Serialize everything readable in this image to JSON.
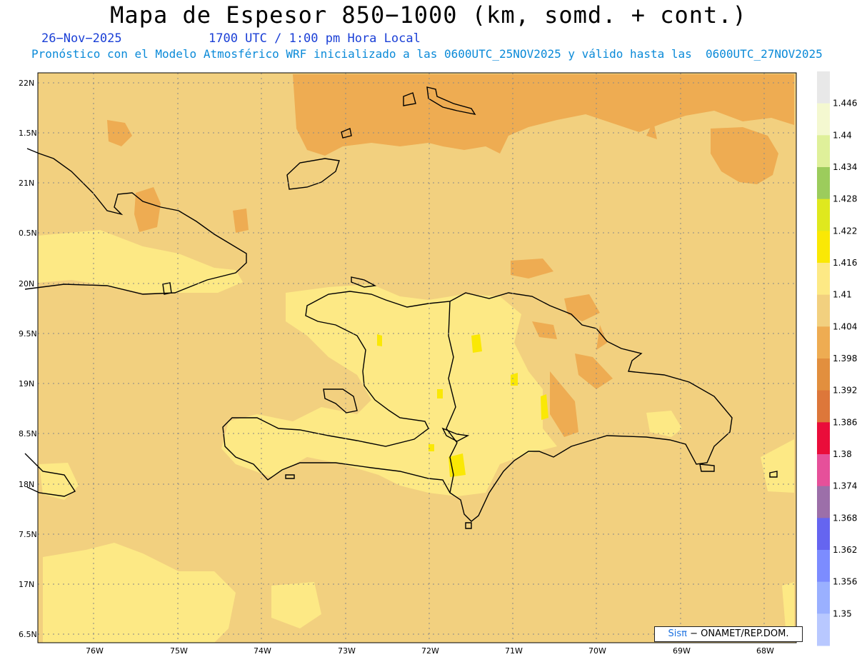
{
  "header": {
    "title": "Mapa de Espesor 850−1000 (km, somd. + cont.)",
    "date": "26−Nov−2025",
    "time": "1700 UTC / 1:00 pm Hora Local",
    "description": "Pronóstico con el Modelo Atmosférico WRF inicializado a las 0600UTC_25NOV2025 y válido hasta las  0600UTC_27NOV2025"
  },
  "map": {
    "lat_labels": [
      "22N",
      "1.5N",
      "21N",
      "0.5N",
      "20N",
      "9.5N",
      "19N",
      "8.5N",
      "18N",
      "7.5N",
      "17N",
      "6.5N"
    ],
    "lon_labels": [
      "76W",
      "75W",
      "74W",
      "73W",
      "72W",
      "71W",
      "70W",
      "69W",
      "68W"
    ],
    "background_color": "#f2d07f",
    "coast_color": "#000000"
  },
  "colorbar": {
    "labels": [
      "1.446",
      "1.44",
      "1.434",
      "1.428",
      "1.422",
      "1.416",
      "1.41",
      "1.404",
      "1.398",
      "1.392",
      "1.386",
      "1.38",
      "1.374",
      "1.368",
      "1.362",
      "1.356",
      "1.35"
    ],
    "colors": [
      "#e8e8e8",
      "#f4f8d0",
      "#dff09a",
      "#9ccc5c",
      "#dfe81e",
      "#fae805",
      "#fde985",
      "#f2d07f",
      "#eeac52",
      "#e28f3e",
      "#dd773a",
      "#ea0d3a",
      "#e6509a",
      "#9c6fa9",
      "#6565f0",
      "#7c8cff",
      "#9ab0ff",
      "#b8c8ff"
    ]
  },
  "credit": {
    "logo": "Sisπ",
    "text": "− ONAMET/REP.DOM."
  }
}
